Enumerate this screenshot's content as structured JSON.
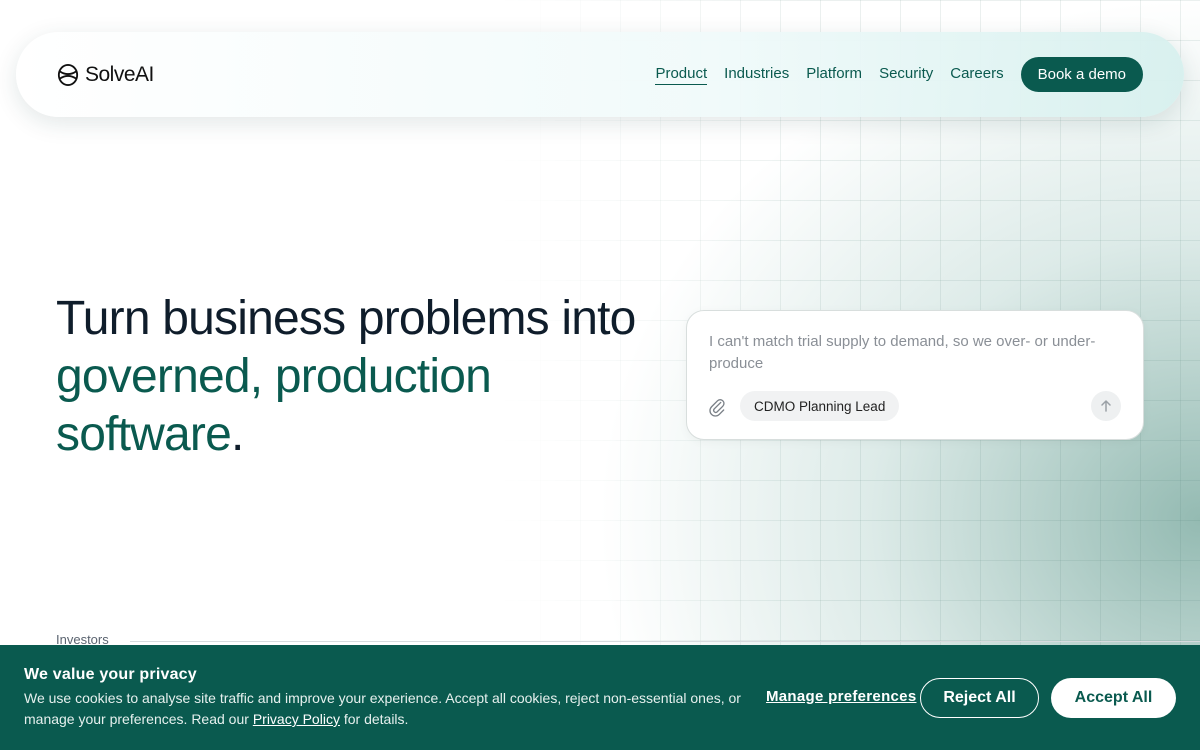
{
  "brand": {
    "name": "SolveAI",
    "logo_icon": "solveai-logo-icon"
  },
  "nav": {
    "links": [
      {
        "label": "Product",
        "active": true
      },
      {
        "label": "Industries",
        "active": false
      },
      {
        "label": "Platform",
        "active": false
      },
      {
        "label": "Security",
        "active": false
      },
      {
        "label": "Careers",
        "active": false
      }
    ],
    "cta_label": "Book a demo"
  },
  "hero": {
    "line1": "Turn business problems into",
    "line2": "governed, production",
    "line3": "software",
    "period": "."
  },
  "chat": {
    "prompt_text": "I can't match trial supply to demand, so we over- or under-produce",
    "attach_icon": "paperclip-icon",
    "role_tag": "CDMO Planning Lead",
    "send_icon": "arrow-up-icon"
  },
  "investors": {
    "label": "Investors"
  },
  "cookie": {
    "title": "We value your privacy",
    "body": "We use cookies to analyse site traffic and improve your experience. Accept all cookies, reject non-essential ones, or manage your preferences. Read our ",
    "policy_link": "Privacy Policy",
    "body_end": " for details.",
    "manage_label": "Manage preferences",
    "reject_label": "Reject All",
    "accept_label": "Accept All"
  },
  "colors": {
    "brand_green": "#0a5a4f",
    "text_dark": "#0f1d2b"
  }
}
